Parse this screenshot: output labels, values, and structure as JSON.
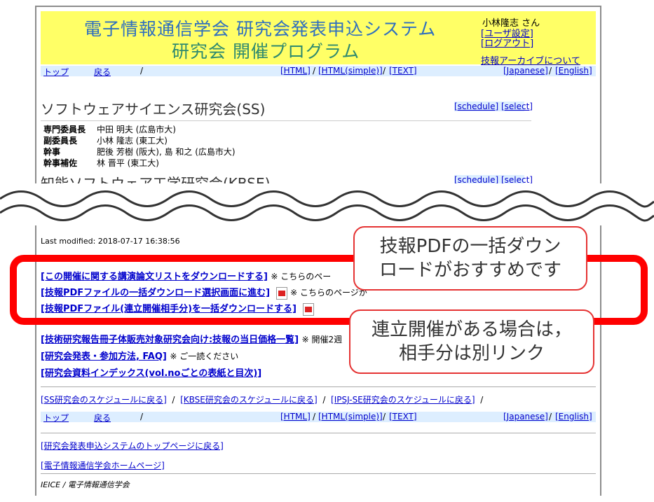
{
  "header": {
    "title_line1": "電子情報通信学会 研究会発表申込システム",
    "title_line2": "研究会 開催プログラム",
    "user_name": "小林隆志 さん",
    "user_settings": "[ユーザ設定]",
    "logout": "[ログアウト]",
    "archive": "技報アーカイブについて"
  },
  "nav": {
    "top": "トップ",
    "back": "戻る",
    "sep": "/",
    "html": "[HTML]",
    "html_simple": "[HTML(simple)]",
    "text": "[TEXT]",
    "japanese": "[Japanese]",
    "english": "[English]"
  },
  "committees": [
    {
      "title": "ソフトウェアサイエンス研究会(SS)",
      "schedule": "[schedule]",
      "select": "[select]",
      "roles": [
        {
          "role": "専門委員長",
          "member": "中田 明夫 (広島市大)"
        },
        {
          "role": "副委員長",
          "member": "小林 隆志 (東工大)"
        },
        {
          "role": "幹事",
          "member": "肥後 芳樹 (阪大), 島 和之 (広島市大)"
        },
        {
          "role": "幹事補佐",
          "member": "林 晋平 (東工大)"
        }
      ]
    },
    {
      "title": "知能ソフトウェア工学研究会(KBSE)",
      "schedule": "[schedule]",
      "select": "[select]"
    }
  ],
  "last_modified": "Last modified: 2018-07-17 16:38:56",
  "links": {
    "download_list": "[この開催に関する講演論文リストをダウンロードする]",
    "download_list_note": "※ こちらのペー",
    "bulk_select": "[技報PDFファイルの一括ダウンロード選択画面に進む]",
    "bulk_select_note": "※ こちらのページか",
    "bulk_joint": "[技報PDFファイル(連立開催相手分)を一括ダウンロードする]",
    "price_list": "[技術研究報告冊子体販売対象研究会向け:技報の当日価格一覧]",
    "price_list_note": "※ 開催2週",
    "faq": "[研究会発表・参加方法, FAQ]",
    "faq_note": "※ ご一読ください",
    "index": "[研究会資料インデックス(vol.noごとの表紙と目次)]"
  },
  "schedule_links": {
    "ss": "[SS研究会のスケジュールに戻る]",
    "kbse": "[KBSE研究会のスケジュールに戻る]",
    "ipsj": "[IPSJ-SE研究会のスケジュールに戻る]",
    "sep": "/"
  },
  "footer": {
    "system_top": "[研究会発表申込システムのトップページに戻る]",
    "ieice_home": "[電子情報通信学会ホームページ]",
    "copyright": "IEICE / 電子情報通信学会"
  },
  "callouts": {
    "recommend": "技報PDFの一括ダウンロードがおすすめです",
    "joint": "連立開催がある場合は，相手分は別リンク"
  },
  "colors": {
    "header_bg": "#ffff66",
    "nav_bg": "#ddeeff",
    "highlight": "#ff0000",
    "link": "#0000cc"
  }
}
